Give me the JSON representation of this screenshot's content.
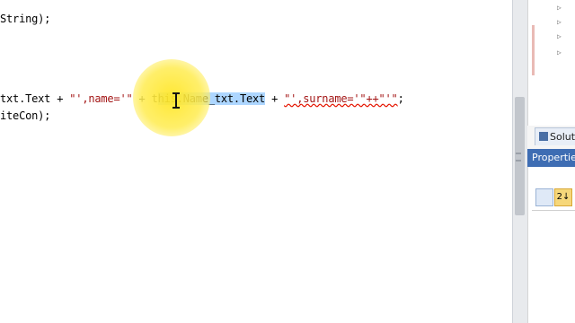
{
  "editor": {
    "lines": [
      {
        "id": "line-1",
        "tokens": [
          {
            "text": "String);",
            "kind": "code"
          }
        ]
      },
      {
        "id": "line-2",
        "tokens": [
          {
            "text": "txt.Text + ",
            "kind": "code"
          },
          {
            "text": "\"',name='\"",
            "kind": "str"
          },
          {
            "text": " + t",
            "kind": "code"
          },
          {
            "text": "his.Name_txt.Text",
            "kind": "sel"
          },
          {
            "text": " + ",
            "kind": "code"
          },
          {
            "text": "\"',surname='\"++\"'\"",
            "kind": "err"
          },
          {
            "text": ";",
            "kind": "code"
          }
        ]
      },
      {
        "id": "line-3",
        "tokens": [
          {
            "text": "iteCon);",
            "kind": "code"
          }
        ]
      }
    ]
  },
  "solution_explorer": {
    "tab_label": "Solut"
  },
  "properties": {
    "header": "Properties",
    "sort_button_label": "2↓"
  },
  "colors": {
    "selection": "#add6ff",
    "string": "#a31515",
    "squiggle": "#e51400",
    "panel_header": "#3e6db3",
    "cursor_highlight": "#ffe628"
  }
}
